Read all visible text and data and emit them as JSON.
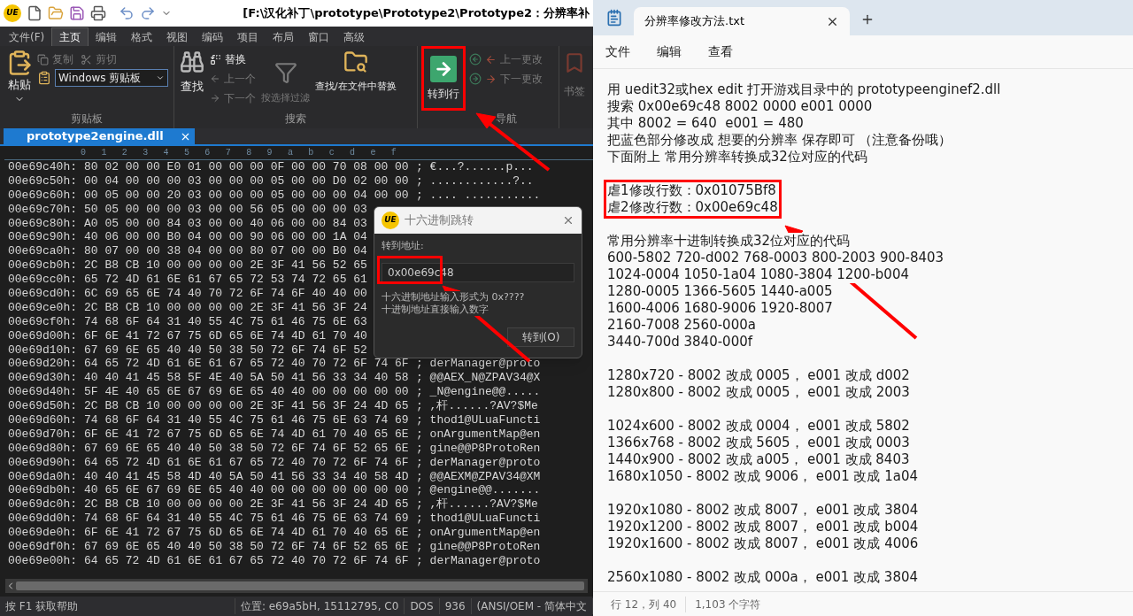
{
  "editor": {
    "title_bar": {
      "logo_text": "UE",
      "title": "[F:\\汉化补丁\\prototype\\Prototype2\\Prototype2：分辨率补"
    },
    "menu_tabs": [
      {
        "label": "文件(F)",
        "selected": false
      },
      {
        "label": "主页",
        "selected": true
      },
      {
        "label": "编辑",
        "selected": false
      },
      {
        "label": "格式",
        "selected": false
      },
      {
        "label": "视图",
        "selected": false
      },
      {
        "label": "编码",
        "selected": false
      },
      {
        "label": "项目",
        "selected": false
      },
      {
        "label": "布局",
        "selected": false
      },
      {
        "label": "窗口",
        "selected": false
      },
      {
        "label": "高级",
        "selected": false
      }
    ],
    "ribbon": {
      "clipboard": {
        "label": "剪贴板",
        "paste": "粘贴",
        "copy": {
          "label": "复制",
          "disabled": true
        },
        "cut": {
          "label": "剪切",
          "disabled": true
        },
        "clipboard_select": "Windows 剪贴板"
      },
      "search": {
        "label": "搜索",
        "find": "查找",
        "replace": {
          "label": "替换",
          "disabled": false
        },
        "previous": {
          "label": "上一个",
          "disabled": true
        },
        "next": {
          "label": "下一个",
          "disabled": true
        },
        "filter": {
          "label": "按选择过滤",
          "disabled": true
        },
        "find_in_files": "查找/在文件中替换"
      },
      "navigation": {
        "label": "导航",
        "goto_line": {
          "label": "转到行",
          "highlighted": true
        },
        "previous_change": {
          "label": "上一更改",
          "disabled": true
        },
        "next_change": {
          "label": "下一更改",
          "disabled": true
        }
      },
      "bookmarks": {
        "label": "书签",
        "disabled": true
      }
    },
    "file_tabs": [
      {
        "label": "prototype2engine.dll",
        "selected": true
      }
    ],
    "hex_columns": [
      "0",
      "1",
      "2",
      "3",
      "4",
      "5",
      "6",
      "7",
      "8",
      "9",
      "a",
      "b",
      "c",
      "d",
      "e",
      "f"
    ],
    "hex_rows": [
      {
        "address": "00e69c40h:",
        "bytes": "80 02 00 00 E0 01 00 00 00 0F 00 00 70 08 00 00",
        "ascii": "; €...?......p..."
      },
      {
        "address": "00e69c50h:",
        "bytes": "00 04 00 00 00 03 00 00 00 05 00 00 D0 02 00 00",
        "ascii": "; ............?.."
      },
      {
        "address": "00e69c60h:",
        "bytes": "00 05 00 00 20 03 00 00 00 05 00 00 00 04 00 00",
        "ascii": "; .... ..........."
      },
      {
        "address": "00e69c70h:",
        "bytes": "50 05 00 00 00 03 00 00 56 05 00 00 00 03"
      },
      {
        "address": "00e69c80h:",
        "bytes": "A0 05 00 00 84 03 00 00 40 06 00 00 84 03"
      },
      {
        "address": "00e69c90h:",
        "bytes": "40 06 00 00 B0 04 00 00 90 06 00 00 1A 04"
      },
      {
        "address": "00e69ca0h:",
        "bytes": "80 07 00 00 38 04 00 00 80 07 00 00 B0 04"
      },
      {
        "address": "00e69cb0h:",
        "bytes": "2C B8 CB 10 00 00 00 00 2E 3F 41 56 52 65"
      },
      {
        "address": "00e69cc0h:",
        "bytes": "65 72 4D 61 6E 61 67 65 72 53 74 72 65 61"
      },
      {
        "address": "00e69cd0h:",
        "bytes": "6C 69 65 6E 74 40 70 72 6F 74 6F 40 40 00"
      },
      {
        "address": "00e69ce0h:",
        "bytes": "2C B8 CB 10 00 00 00 00 2E 3F 41 56 3F 24"
      },
      {
        "address": "00e69cf0h:",
        "bytes": "74 68 6F 64 31 40 55 4C 75 61 46 75 6E 63"
      },
      {
        "address": "00e69d00h:",
        "bytes": "6F 6E 41 72 67 75 6D 65 6E 74 4D 61 70 40"
      },
      {
        "address": "00e69d10h:",
        "bytes": "67 69 6E 65 40 40 50 38 50 72 6F 74 6F 52"
      },
      {
        "address": "00e69d20h:",
        "bytes": "64 65 72 4D 61 6E 61 67 65 72 40 70 72 6F 74 6F",
        "ascii": "; derManager@proto"
      },
      {
        "address": "00e69d30h:",
        "bytes": "40 40 41 45 58 5F 4E 40 5A 50 41 56 33 34 40 58",
        "ascii": "; @@AEX_N@ZPAV34@X"
      },
      {
        "address": "00e69d40h:",
        "bytes": "5F 4E 40 65 6E 67 69 6E 65 40 40 00 00 00 00 00",
        "ascii": "; _N@engine@@....."
      },
      {
        "address": "00e69d50h:",
        "bytes": "2C B8 CB 10 00 00 00 00 2E 3F 41 56 3F 24 4D 65",
        "ascii": "; ,杆......?AV?$Me"
      },
      {
        "address": "00e69d60h:",
        "bytes": "74 68 6F 64 31 40 55 4C 75 61 46 75 6E 63 74 69",
        "ascii": "; thod1@ULuaFuncti"
      },
      {
        "address": "00e69d70h:",
        "bytes": "6F 6E 41 72 67 75 6D 65 6E 74 4D 61 70 40 65 6E",
        "ascii": "; onArgumentMap@en"
      },
      {
        "address": "00e69d80h:",
        "bytes": "67 69 6E 65 40 40 50 38 50 72 6F 74 6F 52 65 6E",
        "ascii": "; gine@@P8ProtoRen"
      },
      {
        "address": "00e69d90h:",
        "bytes": "64 65 72 4D 61 6E 61 67 65 72 40 70 72 6F 74 6F",
        "ascii": "; derManager@proto"
      },
      {
        "address": "00e69da0h:",
        "bytes": "40 40 41 45 58 4D 40 5A 50 41 56 33 34 40 58 4D",
        "ascii": "; @@AEXM@ZPAV34@XM"
      },
      {
        "address": "00e69db0h:",
        "bytes": "40 65 6E 67 69 6E 65 40 40 00 00 00 00 00 00 00",
        "ascii": "; @engine@@......."
      },
      {
        "address": "00e69dc0h:",
        "bytes": "2C B8 CB 10 00 00 00 00 2E 3F 41 56 3F 24 4D 65",
        "ascii": "; ,杆......?AV?$Me"
      },
      {
        "address": "00e69dd0h:",
        "bytes": "74 68 6F 64 31 40 55 4C 75 61 46 75 6E 63 74 69",
        "ascii": "; thod1@ULuaFuncti"
      },
      {
        "address": "00e69de0h:",
        "bytes": "6F 6E 41 72 67 75 6D 65 6E 74 4D 61 70 40 65 6E",
        "ascii": "; onArgumentMap@en"
      },
      {
        "address": "00e69df0h:",
        "bytes": "67 69 6E 65 40 40 50 38 50 72 6F 74 6F 52 65 6E",
        "ascii": "; gine@@P8ProtoRen"
      },
      {
        "address": "00e69e00h:",
        "bytes": "64 65 72 4D 61 6E 61 67 65 72 40 70 72 6F 74 6F",
        "ascii": "; derManager@proto"
      }
    ],
    "status_bar": [
      "按 F1 获取帮助",
      "位置: e69a5bH, 15112795, C0",
      "DOS",
      "936",
      "(ANSI/OEM - 简体中文"
    ]
  },
  "dialog": {
    "logo_text": "UE",
    "title": "十六进制跳转",
    "label": "转到地址:",
    "value": "0x00e69c48",
    "value_highlighted": true,
    "hints": [
      "十六进制地址输入形式为 0x????",
      "十进制地址直接输入数字"
    ],
    "button": "转到(O)"
  },
  "notepad": {
    "tab": {
      "title": "分辨率修改方法.txt",
      "selected": true
    },
    "menu": [
      "文件",
      "编辑",
      "查看"
    ],
    "blocks": [
      {
        "highlighted": false,
        "lines": [
          "用 uedit32或hex edit 打开游戏目录中的 prototypeenginef2.dll",
          "搜索 0x00e69c48 8002 0000 e001 0000",
          "其中 8002 = 640  e001 = 480",
          "把蓝色部分修改成 想要的分辨率 保存即可 （注意备份哦）",
          "下面附上 常用分辨率转换成32位对应的代码"
        ]
      },
      {
        "highlighted": true,
        "lines": [
          "虐1修改行数：0x01075Bf8",
          "虐2修改行数：0x00e69c48"
        ]
      },
      {
        "highlighted": false,
        "lines": [
          "常用分辨率十进制转换成32位对应的代码",
          "600-5802 720-d002 768-0003 800-2003 900-8403",
          "1024-0004 1050-1a04 1080-3804 1200-b004",
          "1280-0005 1366-5605 1440-a005",
          "1600-4006 1680-9006 1920-8007",
          "2160-7008 2560-000a",
          "3440-700d 3840-000f"
        ]
      },
      {
        "highlighted": false,
        "lines": [
          "1280x720 - 8002 改成 0005， e001 改成 d002",
          "1280x800 - 8002 改成 0005， e001 改成 2003"
        ]
      },
      {
        "highlighted": false,
        "lines": [
          "1024x600 - 8002 改成 0004， e001 改成 5802",
          "1366x768 - 8002 改成 5605， e001 改成 0003",
          "1440x900 - 8002 改成 a005， e001 改成 8403",
          "1680x1050 - 8002 改成 9006， e001 改成 1a04"
        ]
      },
      {
        "highlighted": false,
        "lines": [
          "1920x1080 - 8002 改成 8007， e001 改成 3804",
          "1920x1200 - 8002 改成 8007， e001 改成 b004",
          "1920x1600 - 8002 改成 8007， e001 改成 4006"
        ]
      },
      {
        "highlighted": false,
        "lines": [
          "2560x1080 - 8002 改成 000a， e001 改成 3804"
        ]
      }
    ],
    "status_bar": [
      "行 12，列 40",
      "1,103 个字符"
    ]
  }
}
